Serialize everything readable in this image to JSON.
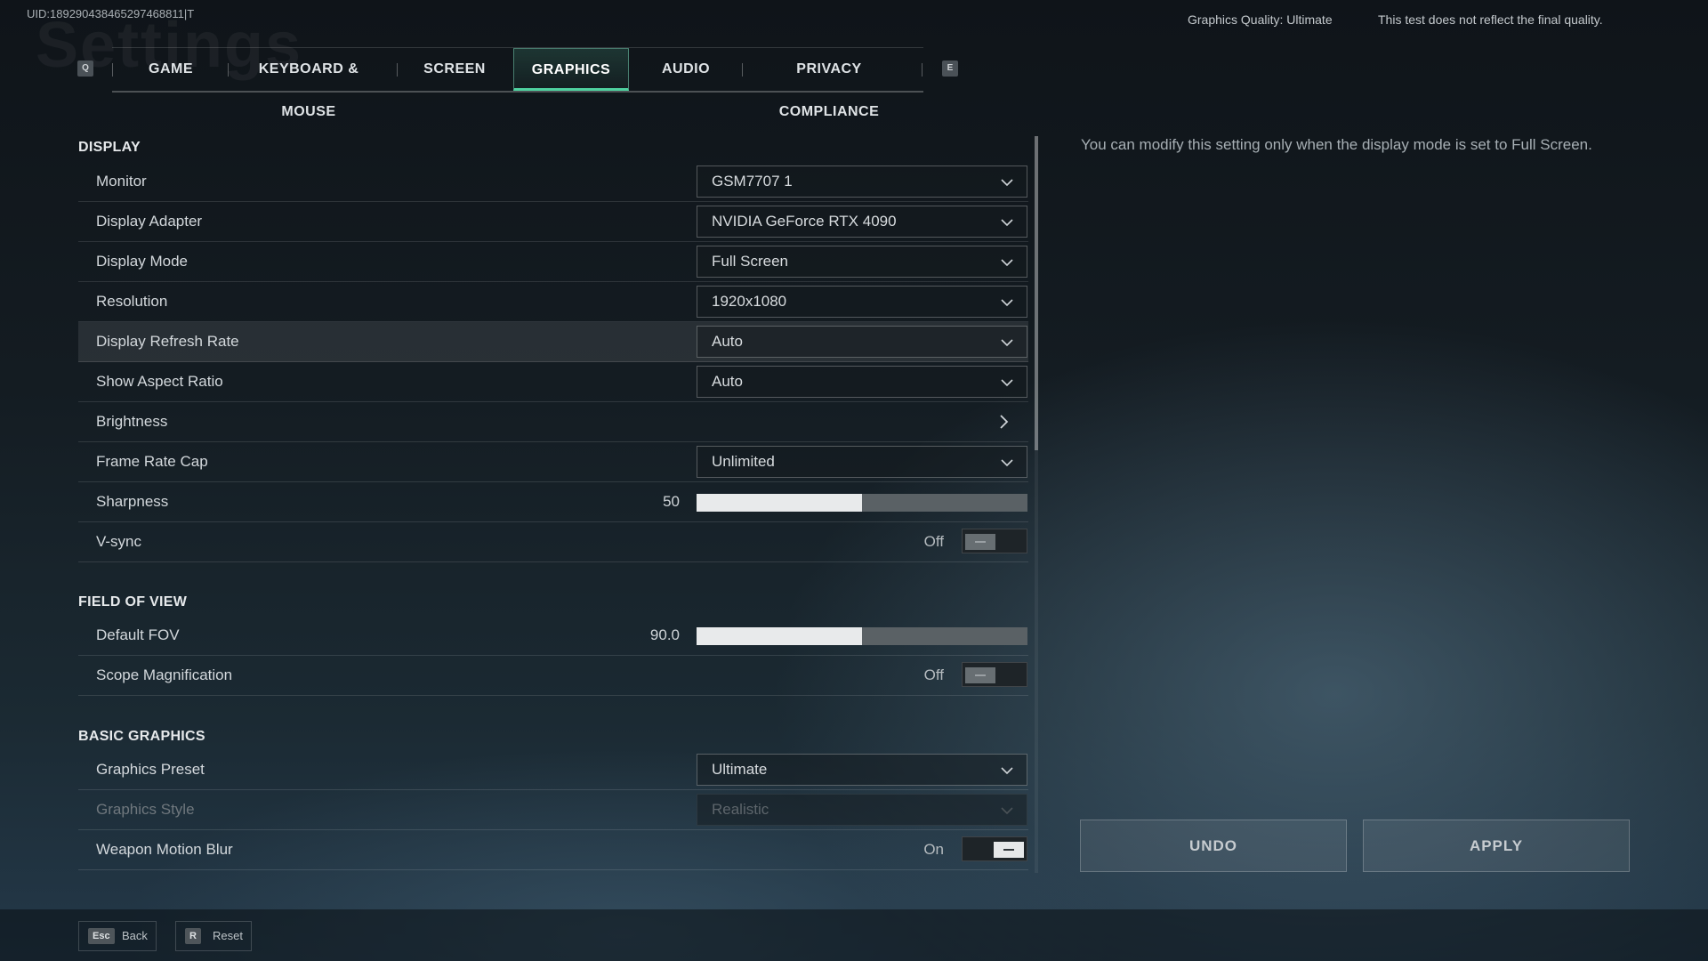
{
  "header": {
    "uid": "UID:189290438465297468811|T",
    "watermark_title": "Settings",
    "graphics_quality": "Graphics Quality: Ultimate",
    "disclaimer": "This test does not reflect the final quality."
  },
  "tabs": {
    "prev_key": "Q",
    "next_key": "E",
    "items": [
      "GAME",
      "KEYBOARD & MOUSE",
      "SCREEN",
      "GRAPHICS",
      "AUDIO",
      "PRIVACY COMPLIANCE"
    ],
    "active": "GRAPHICS"
  },
  "sections": {
    "display": "DISPLAY",
    "field_of_view": "FIELD OF VIEW",
    "basic_graphics": "BASIC GRAPHICS"
  },
  "settings": {
    "monitor": {
      "label": "Monitor",
      "value": "GSM7707 1"
    },
    "display_adapter": {
      "label": "Display Adapter",
      "value": "NVIDIA GeForce RTX 4090"
    },
    "display_mode": {
      "label": "Display Mode",
      "value": "Full Screen"
    },
    "resolution": {
      "label": "Resolution",
      "value": "1920x1080"
    },
    "display_refresh_rate": {
      "label": "Display Refresh Rate",
      "value": "Auto"
    },
    "show_aspect_ratio": {
      "label": "Show Aspect Ratio",
      "value": "Auto"
    },
    "brightness": {
      "label": "Brightness"
    },
    "frame_rate_cap": {
      "label": "Frame Rate Cap",
      "value": "Unlimited"
    },
    "sharpness": {
      "label": "Sharpness",
      "value": "50",
      "fill_fraction": 0.5
    },
    "vsync": {
      "label": "V-sync",
      "state": "Off"
    },
    "default_fov": {
      "label": "Default FOV",
      "value": "90.0",
      "fill_fraction": 0.5
    },
    "scope_magnification": {
      "label": "Scope Magnification",
      "state": "Off"
    },
    "graphics_preset": {
      "label": "Graphics Preset",
      "value": "Ultimate"
    },
    "graphics_style": {
      "label": "Graphics Style",
      "value": "Realistic"
    },
    "weapon_motion_blur": {
      "label": "Weapon Motion Blur",
      "state": "On"
    }
  },
  "description": "You can modify this setting only when the display mode is set to Full Screen.",
  "buttons": {
    "undo": "UNDO",
    "apply": "APPLY"
  },
  "footer": {
    "back_key": "Esc",
    "back_label": "Back",
    "reset_key": "R",
    "reset_label": "Reset"
  },
  "colors": {
    "accent": "#4fd1a0",
    "slider_fill": "#e8eaeb"
  }
}
